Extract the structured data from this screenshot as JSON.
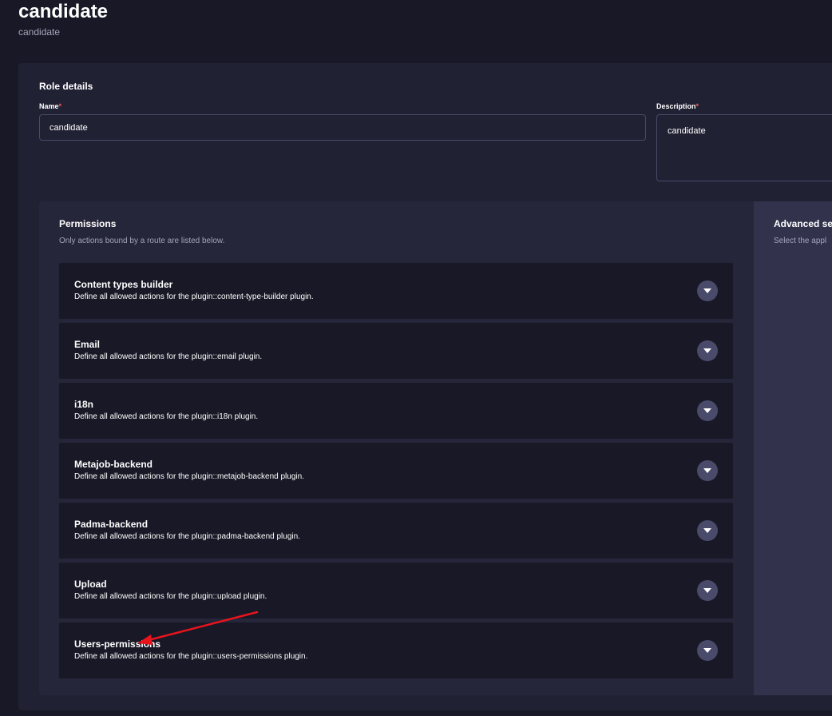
{
  "header": {
    "title": "candidate",
    "subtitle": "candidate"
  },
  "role_details": {
    "title": "Role details",
    "name_label": "Name",
    "name_value": "candidate",
    "description_label": "Description",
    "description_value": "candidate",
    "required_mark": "*"
  },
  "permissions": {
    "title": "Permissions",
    "subtitle": "Only actions bound by a route are listed below.",
    "plugins": [
      {
        "name": "Content types builder",
        "description": "Define all allowed actions for the plugin::content-type-builder plugin."
      },
      {
        "name": "Email",
        "description": "Define all allowed actions for the plugin::email plugin."
      },
      {
        "name": "i18n",
        "description": "Define all allowed actions for the plugin::i18n plugin."
      },
      {
        "name": "Metajob-backend",
        "description": "Define all allowed actions for the plugin::metajob-backend plugin."
      },
      {
        "name": "Padma-backend",
        "description": "Define all allowed actions for the plugin::padma-backend plugin."
      },
      {
        "name": "Upload",
        "description": "Define all allowed actions for the plugin::upload plugin."
      },
      {
        "name": "Users-permissions",
        "description": "Define all allowed actions for the plugin::users-permissions plugin."
      }
    ]
  },
  "advanced": {
    "title": "Advanced se",
    "subtitle": "Select the appl"
  },
  "icons": {
    "expand": "chevron-down-icon"
  },
  "colors": {
    "background": "#181826",
    "card": "#212134",
    "required": "#ee5e52",
    "annotation_arrow": "#e8141c"
  }
}
